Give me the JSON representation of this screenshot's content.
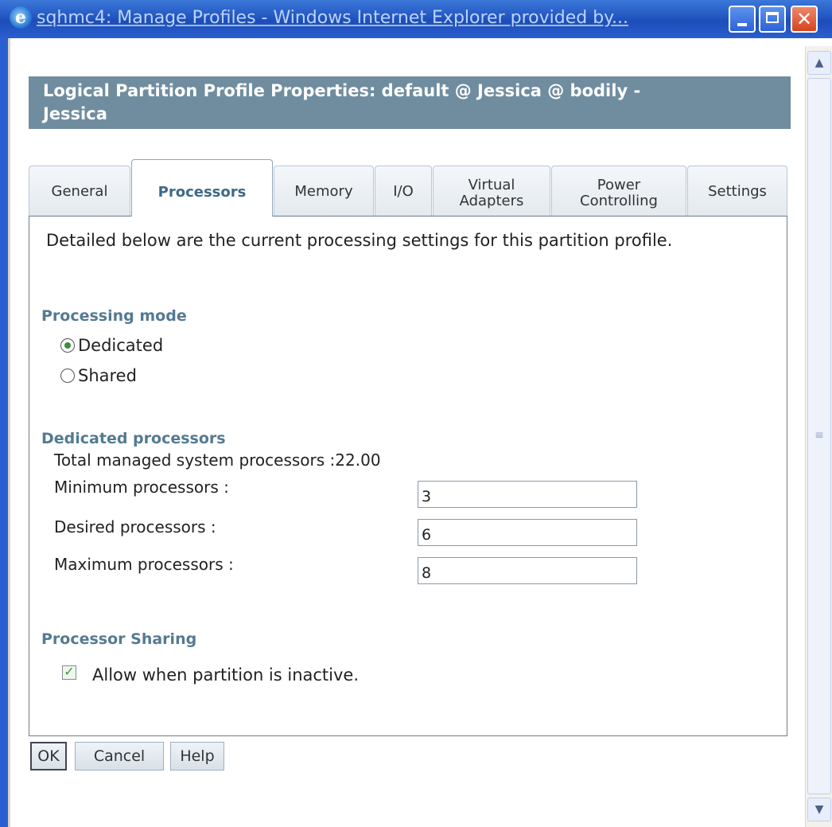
{
  "window": {
    "title": "sqhmc4: Manage Profiles - Windows Internet Explorer provided by...",
    "ie_icon": "e",
    "close_glyph": "✕"
  },
  "header": {
    "line1": "Logical Partition Profile Properties: default @ Jessica @ bodily -",
    "line2": "Jessica"
  },
  "tabs": [
    {
      "label": "General"
    },
    {
      "label": "Processors",
      "active": true
    },
    {
      "label": "Memory"
    },
    {
      "label": "I/O"
    },
    {
      "label_line1": "Virtual",
      "label_line2": "Adapters"
    },
    {
      "label_line1": "Power",
      "label_line2": "Controlling"
    },
    {
      "label": "Settings"
    }
  ],
  "intro": "Detailed below are the current processing settings for this partition profile.",
  "processing_mode": {
    "title": "Processing mode",
    "options": [
      {
        "label": "Dedicated",
        "selected": true
      },
      {
        "label": "Shared",
        "selected": false
      }
    ]
  },
  "dedicated": {
    "title": "Dedicated processors",
    "total_label": "Total managed system processors :",
    "total_value": "22.00",
    "min_label": "Minimum processors :",
    "min_value": "3",
    "desired_label": "Desired processors :",
    "desired_value": "6",
    "max_label": "Maximum processors :",
    "max_value": "8"
  },
  "sharing": {
    "title": "Processor Sharing",
    "allow_label": "Allow when partition is inactive.",
    "allow_checked": true
  },
  "buttons": {
    "ok": "OK",
    "cancel": "Cancel",
    "help": "Help"
  },
  "colors": {
    "header_bg": "#6f8d9f",
    "section_title": "#547a92",
    "titlebar": "#2356c2"
  }
}
